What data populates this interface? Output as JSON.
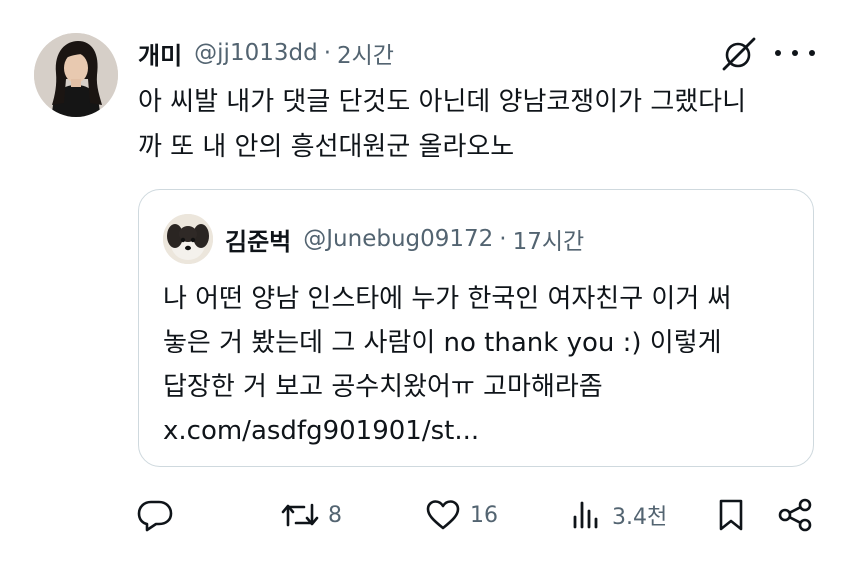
{
  "tweet": {
    "author_name": "개미",
    "handle": "@jj1013dd",
    "separator": "·",
    "time": "2시간",
    "text_lines": [
      "아 씨발 내가 댓글 단것도 아닌데 양남코쟁이가 그랬다니",
      "까 또 내 안의 흥선대원군 올라오노"
    ]
  },
  "quote": {
    "author_name": "김준벅",
    "handle": "@Junebug09172",
    "separator": "·",
    "time": "17시간",
    "text_lines": [
      "나 어떤 양남 인스타에 누가 한국인 여자친구 이거 써",
      "놓은 거 봤는데 그 사람이 no thank you :) 이렇게",
      "답장한 거 보고 공수치왔어ㅠ 고마해라좀",
      "x.com/asdfg901901/st..."
    ]
  },
  "actions": {
    "reply_count": "",
    "retweet_count": "8",
    "like_count": "16",
    "view_count": "3.4천"
  },
  "icons": {
    "grok": "grok-icon",
    "more": "more-icon",
    "reply": "reply-icon",
    "retweet": "retweet-icon",
    "like": "like-icon",
    "views": "views-icon",
    "bookmark": "bookmark-icon",
    "share": "share-icon"
  },
  "colors": {
    "text": "#0f1419",
    "secondary": "#536471",
    "border": "#cfd9de"
  }
}
